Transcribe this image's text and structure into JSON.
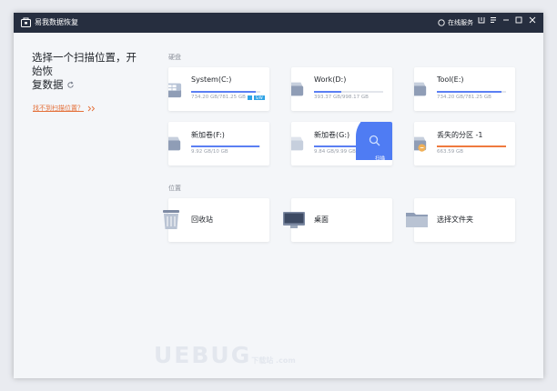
{
  "titlebar": {
    "title": "易我数据恢复",
    "online_service": "在线服务",
    "buttons": [
      "upload-icon",
      "menu-icon",
      "minimize-icon",
      "maximize-icon",
      "close-icon"
    ]
  },
  "left": {
    "heading_line1": "选择一个扫描位置，开始恢",
    "heading_line2": "复数据",
    "cant_find_link": "找不到扫描位置？"
  },
  "sections": {
    "disks_label": "硬盘",
    "locations_label": "位置"
  },
  "disks": [
    {
      "name": "System(C:)",
      "size": "734.20 GB/781.25 GB",
      "usage": 0.94,
      "bar_color": "#5b7ff3",
      "icon": "windows-drive-icon",
      "badge": "S/W"
    },
    {
      "name": "Work(D:)",
      "size": "393.37 GB/998.17 GB",
      "usage": 0.39,
      "bar_color": "#5b7ff3",
      "icon": "hard-drive-icon"
    },
    {
      "name": "Tool(E:)",
      "size": "734.20 GB/781.25 GB",
      "usage": 0.94,
      "bar_color": "#5b7ff3",
      "icon": "hard-drive-icon"
    },
    {
      "name": "新加卷(F:)",
      "size": "9.92 GB/10 GB",
      "usage": 0.99,
      "bar_color": "#5b7ff3",
      "icon": "hard-drive-icon"
    },
    {
      "name": "新加卷(G:)",
      "size": "9.84 GB/9.99 GB",
      "usage": 0.98,
      "bar_color": "#5b7ff3",
      "icon": "hard-drive-icon",
      "scan_label": "扫描"
    },
    {
      "name": "丢失的分区 -1",
      "size": "663.59 GB",
      "usage": 1.0,
      "bar_color": "#ef7a3e",
      "icon": "lost-partition-drive-icon"
    }
  ],
  "locations": [
    {
      "name": "回收站",
      "icon": "recycle-bin-icon"
    },
    {
      "name": "桌面",
      "icon": "desktop-monitor-icon"
    },
    {
      "name": "选择文件夹",
      "icon": "folder-icon"
    }
  ],
  "watermark": {
    "main": "UEBUG",
    "sub": "下载站 .com"
  }
}
